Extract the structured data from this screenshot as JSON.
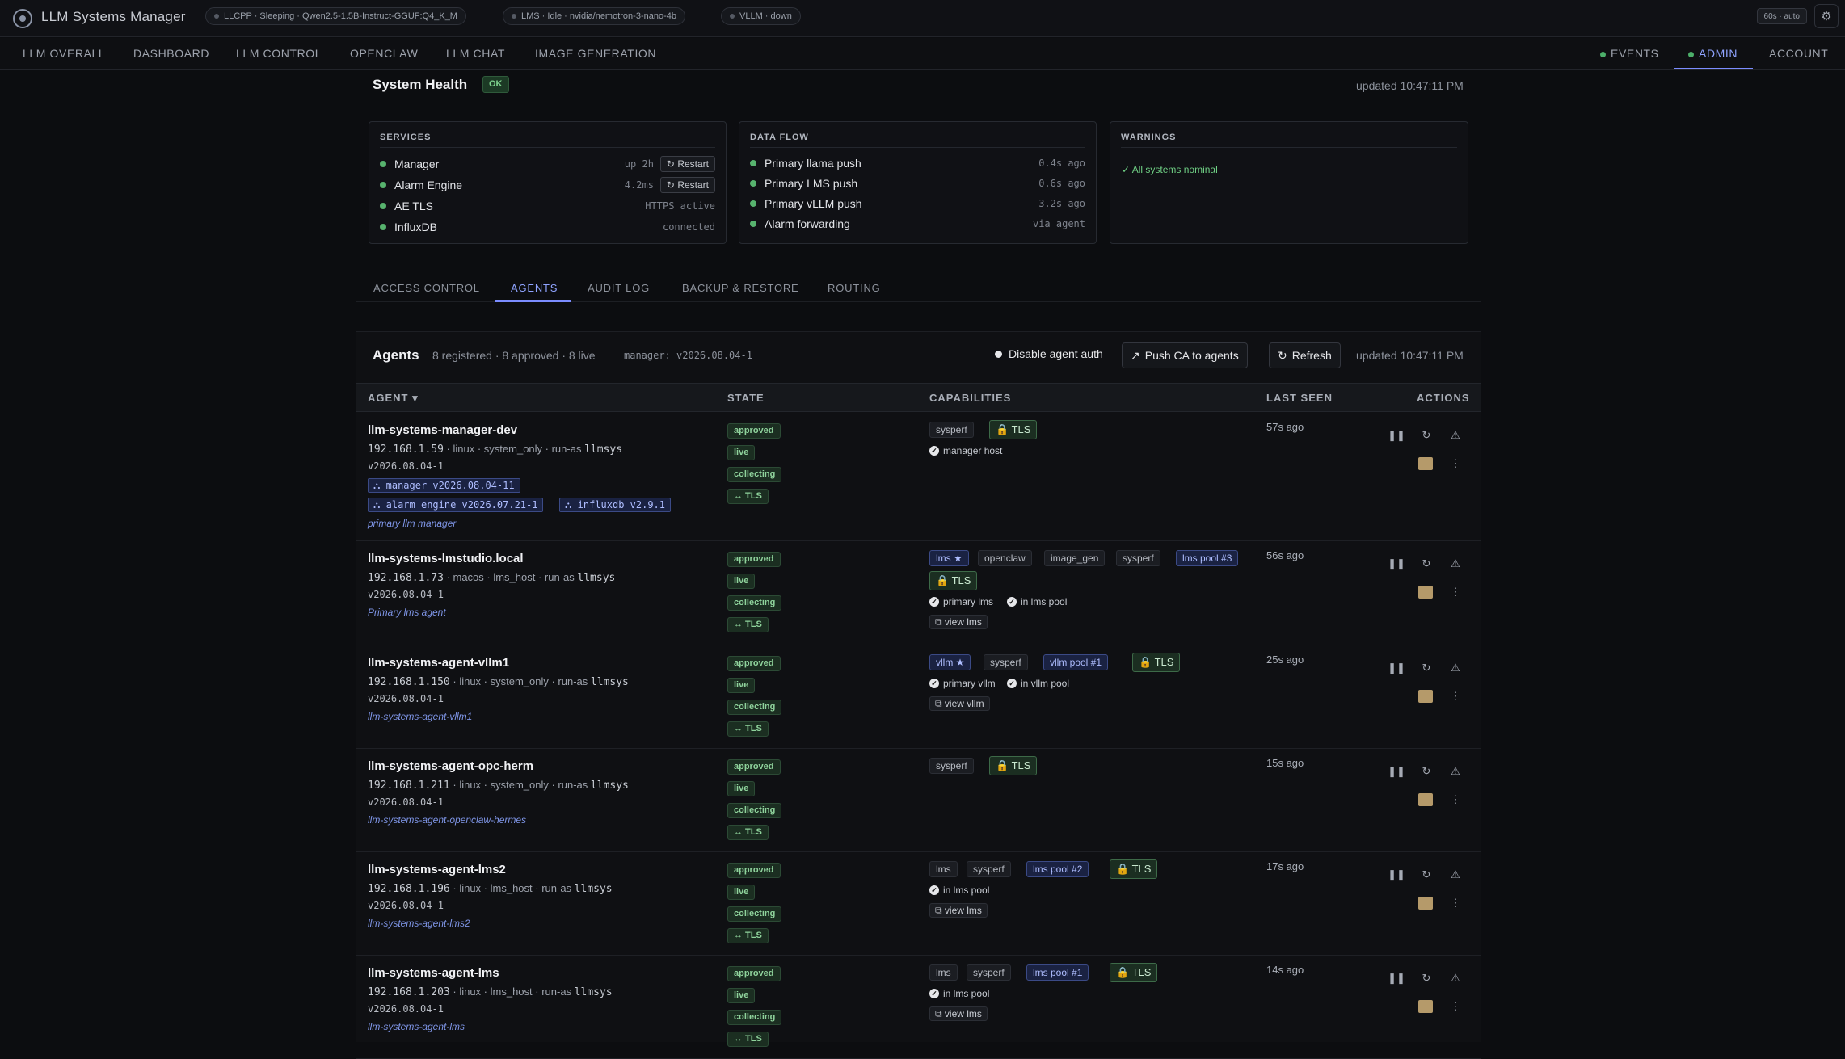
{
  "app": {
    "title": "LLM Systems Manager"
  },
  "top_pills": [
    {
      "text": "LLCPP · Sleeping · Qwen2.5-1.5B-Instruct-GGUF:Q4_K_M"
    },
    {
      "text": "LMS · Idle · nvidia/nemotron-3-nano-4b"
    },
    {
      "text": "VLLM · down"
    }
  ],
  "refresh_pill": "60s · auto",
  "nav": {
    "left": [
      "LLM OVERALL",
      "DASHBOARD",
      "LLM CONTROL",
      "OPENCLAW",
      "LLM CHAT",
      "IMAGE GENERATION"
    ],
    "right": [
      "EVENTS",
      "ADMIN",
      "ACCOUNT"
    ],
    "active": "ADMIN"
  },
  "health": {
    "title": "System Health",
    "status": "OK",
    "updated": "updated 10:47:11 PM",
    "services": {
      "title": "SERVICES",
      "rows": [
        {
          "name": "Manager",
          "value": "up 2h",
          "action": "Restart"
        },
        {
          "name": "Alarm Engine",
          "value": "4.2ms",
          "action": "Restart"
        },
        {
          "name": "AE TLS",
          "value": "HTTPS active"
        },
        {
          "name": "InfluxDB",
          "value": "connected"
        }
      ]
    },
    "data_flow": {
      "title": "DATA FLOW",
      "rows": [
        {
          "name": "Primary llama push",
          "value": "0.4s ago"
        },
        {
          "name": "Primary LMS push",
          "value": "0.6s ago"
        },
        {
          "name": "Primary vLLM push",
          "value": "3.2s ago"
        },
        {
          "name": "Alarm forwarding",
          "value": "via agent"
        }
      ]
    },
    "warnings": {
      "title": "WARNINGS",
      "text": "✓ All systems nominal"
    }
  },
  "subtabs": [
    "ACCESS CONTROL",
    "AGENTS",
    "AUDIT LOG",
    "BACKUP & RESTORE",
    "ROUTING"
  ],
  "agents": {
    "title": "Agents",
    "summary": "8 registered · 8 approved · 8 live",
    "manager_version": "manager: v2026.08.04-1",
    "disable_auth_label": "Disable agent auth",
    "push_ca_label": "Push CA to agents",
    "refresh_label": "Refresh",
    "updated": "updated 10:47:11 PM",
    "columns": [
      "AGENT ▾",
      "STATE",
      "CAPABILITIES",
      "LAST SEEN",
      "ACTIONS"
    ],
    "rows": [
      {
        "name": "llm-systems-manager-dev",
        "ip": "192.168.1.59",
        "os": "linux",
        "role": "system_only",
        "run_as": "llmsys",
        "version": "v2026.08.04-1",
        "components": [
          "⛬ manager v2026.08.04-11",
          "⛬ alarm engine v2026.07.21-1",
          "⛬ influxdb v2.9.1"
        ],
        "note": "primary llm manager",
        "states": [
          "approved",
          "live",
          "collecting",
          "↔ TLS"
        ],
        "caps": [
          {
            "t": "sysperf"
          },
          {
            "t": "🔒 TLS",
            "k": "tls"
          }
        ],
        "caplines": [
          "manager host"
        ],
        "views": [],
        "last_seen": "57s ago"
      },
      {
        "name": "llm-systems-lmstudio.local",
        "ip": "192.168.1.73",
        "os": "macos",
        "role": "lms_host",
        "run_as": "llmsys",
        "version": "v2026.08.04-1",
        "components": [],
        "note": "Primary lms agent",
        "states": [
          "approved",
          "live",
          "collecting",
          "↔ TLS"
        ],
        "caps": [
          {
            "t": "lms ★",
            "k": "blue"
          },
          {
            "t": "openclaw"
          },
          {
            "t": "image_gen"
          },
          {
            "t": "sysperf"
          },
          {
            "t": "lms pool #3",
            "k": "blue"
          },
          {
            "t": "🔒 TLS",
            "k": "tls"
          }
        ],
        "caplines": [
          "primary lms",
          "in lms pool"
        ],
        "views": [
          "⧉ view lms"
        ],
        "last_seen": "56s ago"
      },
      {
        "name": "llm-systems-agent-vllm1",
        "ip": "192.168.1.150",
        "os": "linux",
        "role": "system_only",
        "run_as": "llmsys",
        "version": "v2026.08.04-1",
        "components": [],
        "note": "llm-systems-agent-vllm1",
        "states": [
          "approved",
          "live",
          "collecting",
          "↔ TLS"
        ],
        "caps": [
          {
            "t": "vllm ★",
            "k": "blue"
          },
          {
            "t": "sysperf"
          },
          {
            "t": "vllm pool #1",
            "k": "blue"
          },
          {
            "t": "🔒 TLS",
            "k": "tls"
          }
        ],
        "caplines": [
          "primary vllm",
          "in vllm pool"
        ],
        "views": [
          "⧉ view vllm"
        ],
        "last_seen": "25s ago"
      },
      {
        "name": "llm-systems-agent-opc-herm",
        "ip": "192.168.1.211",
        "os": "linux",
        "role": "system_only",
        "run_as": "llmsys",
        "version": "v2026.08.04-1",
        "components": [],
        "note": "llm-systems-agent-openclaw-hermes",
        "states": [
          "approved",
          "live",
          "collecting",
          "↔ TLS"
        ],
        "caps": [
          {
            "t": "sysperf"
          },
          {
            "t": "🔒 TLS",
            "k": "tls"
          }
        ],
        "caplines": [],
        "views": [],
        "last_seen": "15s ago"
      },
      {
        "name": "llm-systems-agent-lms2",
        "ip": "192.168.1.196",
        "os": "linux",
        "role": "lms_host",
        "run_as": "llmsys",
        "version": "v2026.08.04-1",
        "components": [],
        "note": "llm-systems-agent-lms2",
        "states": [
          "approved",
          "live",
          "collecting",
          "↔ TLS"
        ],
        "caps": [
          {
            "t": "lms"
          },
          {
            "t": "sysperf"
          },
          {
            "t": "lms pool #2",
            "k": "blue"
          },
          {
            "t": "🔒 TLS",
            "k": "tls"
          }
        ],
        "caplines": [
          "in lms pool"
        ],
        "views": [
          "⧉ view lms"
        ],
        "last_seen": "17s ago"
      },
      {
        "name": "llm-systems-agent-lms",
        "ip": "192.168.1.203",
        "os": "linux",
        "role": "lms_host",
        "run_as": "llmsys",
        "version": "v2026.08.04-1",
        "components": [],
        "note": "llm-systems-agent-lms",
        "states": [
          "approved",
          "live",
          "collecting",
          "↔ TLS"
        ],
        "caps": [
          {
            "t": "lms"
          },
          {
            "t": "sysperf"
          },
          {
            "t": "lms pool #1",
            "k": "blue"
          },
          {
            "t": "🔒 TLS",
            "k": "tls"
          }
        ],
        "caplines": [
          "in lms pool"
        ],
        "views": [
          "⧉ view lms"
        ],
        "last_seen": "14s ago"
      }
    ]
  },
  "icons": {
    "pause": "pause-icon",
    "restart": "refresh-icon",
    "alert": "warning-icon",
    "cert": "certificate-icon",
    "more": "more-vertical-icon"
  },
  "colors": {
    "accent": "#7b8cff",
    "ok": "#57b36e",
    "background": "#0c0d10"
  }
}
